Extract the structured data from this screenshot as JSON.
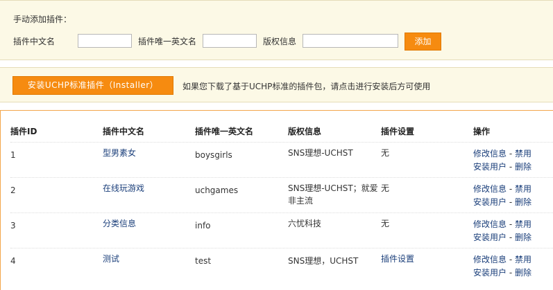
{
  "add_form": {
    "title": "手动添加插件：",
    "cn_name_label": "插件中文名",
    "cn_name_value": "",
    "en_name_label": "插件唯一英文名",
    "en_name_value": "",
    "copyright_label": "版权信息",
    "copyright_value": "",
    "add_button_label": "添加"
  },
  "installer": {
    "button_label": "安装UCHP标准插件（Installer）",
    "hint": "如果您下载了基于UCHP标准的插件包，请点击进行安装后方可使用"
  },
  "table": {
    "headers": [
      "插件ID",
      "插件中文名",
      "插件唯一英文名",
      "版权信息",
      "插件设置",
      "操作"
    ],
    "rows": [
      {
        "id": "1",
        "cn_name": "型男素女",
        "en_name": "boysgirls",
        "copyright": "SNS理想-UCHST",
        "settings": "无",
        "ops": {
          "edit": "修改信息",
          "disable": "禁用",
          "users": "安装用户",
          "delete": "删除"
        }
      },
      {
        "id": "2",
        "cn_name": "在线玩游戏",
        "en_name": "uchgames",
        "copyright": "SNS理想-UCHST；就爱非主流",
        "settings": "无",
        "ops": {
          "edit": "修改信息",
          "disable": "禁用",
          "users": "安装用户",
          "delete": "删除"
        }
      },
      {
        "id": "3",
        "cn_name": "分类信息",
        "en_name": "info",
        "copyright": "六忧科技",
        "settings": "无",
        "ops": {
          "edit": "修改信息",
          "disable": "禁用",
          "users": "安装用户",
          "delete": "删除"
        }
      },
      {
        "id": "4",
        "cn_name": "测试",
        "en_name": "test",
        "copyright": "SNS理想，UCHST",
        "settings": "插件设置",
        "ops": {
          "edit": "修改信息",
          "disable": "禁用",
          "users": "安装用户",
          "delete": "删除"
        }
      }
    ],
    "op_separator": " - "
  },
  "colors": {
    "panel_bg": "#fcf9e6",
    "button_orange": "#f68b10",
    "link_blue": "#1a3e7a",
    "list_border": "#f3a64a"
  }
}
